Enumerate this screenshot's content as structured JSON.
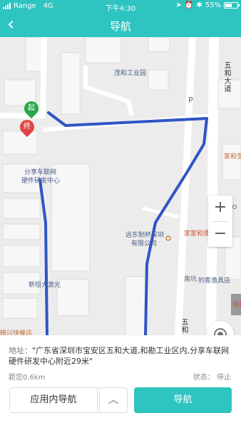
{
  "status_bar": {
    "carrier": "Range",
    "network": "4G",
    "time": "下午4:30",
    "battery_text": "55%",
    "battery_level": 0.55
  },
  "nav": {
    "back_icon": "chevron-left-icon",
    "title": "导航"
  },
  "map": {
    "start_marker": "起",
    "end_marker": "终",
    "labels": {
      "park": "茂和工业园",
      "parking": "P",
      "road_vertical_top": "五和大道",
      "store_right": "家和生",
      "building_left_line1": "分享车联网",
      "building_left_line2": "硬件研发中心",
      "factory_line1": "远东制杯深圳",
      "factory_line2": "有限公司",
      "convenience": "家家和便利店",
      "nankeng": "南坑",
      "fishing": "钓客渔具店",
      "laser": "新恒大激光",
      "express": "腾兴快餐店",
      "road_vertical_bottom": "五和",
      "partial_right": "电脑"
    },
    "colors": {
      "route": "#2f55c6",
      "start": "#2aa84a",
      "end": "#e04545",
      "accent": "#2ec4c0"
    }
  },
  "info": {
    "address_label": "地址：",
    "address_value": "\"广东省深圳市宝安区五和大道,和勘工业区内,分享车联网硬件研发中心附近29米\"",
    "distance": "距您0.6km",
    "status": "状态：  停止"
  },
  "buttons": {
    "inapp": "应用内导航",
    "expand_icon": "chevron-up-icon",
    "navigate": "导航"
  }
}
